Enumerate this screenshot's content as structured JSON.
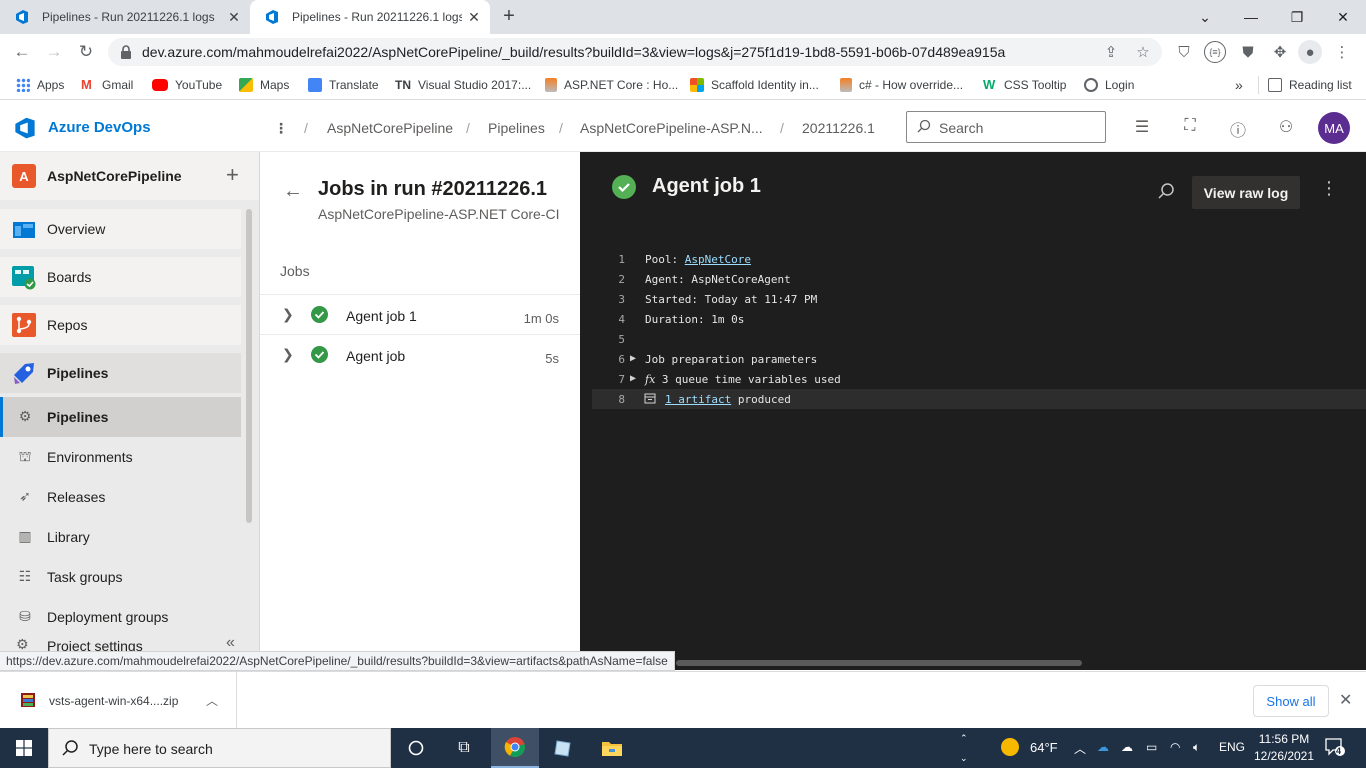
{
  "browser": {
    "tabs": [
      {
        "title": "Pipelines - Run 20211226.1 logs",
        "active": false
      },
      {
        "title": "Pipelines - Run 20211226.1 logs",
        "active": true
      }
    ],
    "url": "dev.azure.com/mahmoudelrefai2022/AspNetCorePipeline/_build/results?buildId=3&view=logs&j=275f1d19-1bd8-5591-b06b-07d489ea915a",
    "bookmarks": [
      "Apps",
      "Gmail",
      "YouTube",
      "Maps",
      "Translate",
      "Visual Studio 2017:...",
      "ASP.NET Core : Ho...",
      "Scaffold Identity in...",
      "c# - How override...",
      "CSS Tooltip",
      "Login"
    ],
    "bookmark_tn_prefix": "TN",
    "reading_list": "Reading list",
    "status_url": "https://dev.azure.com/mahmoudelrefai2022/AspNetCorePipeline/_build/results?buildId=3&view=artifacts&pathAsName=false",
    "overflow": "»"
  },
  "header": {
    "product": "Azure DevOps",
    "breadcrumbs": [
      "AspNetCorePipeline",
      "Pipelines",
      "AspNetCorePipeline-ASP.N...",
      "20211226.1"
    ],
    "search_placeholder": "Search",
    "avatar_initials": "MA"
  },
  "sidebar": {
    "project_initial": "A",
    "project_name": "AspNetCorePipeline",
    "items": [
      {
        "label": "Overview"
      },
      {
        "label": "Boards"
      },
      {
        "label": "Repos"
      },
      {
        "label": "Pipelines"
      }
    ],
    "sub_items": [
      {
        "label": "Pipelines"
      },
      {
        "label": "Environments"
      },
      {
        "label": "Releases"
      },
      {
        "label": "Library"
      },
      {
        "label": "Task groups"
      },
      {
        "label": "Deployment groups"
      }
    ],
    "project_settings": "Project settings"
  },
  "jobs": {
    "title": "Jobs in run #20211226.1",
    "subtitle": "AspNetCorePipeline-ASP.NET Core-CI",
    "section_label": "Jobs",
    "list": [
      {
        "name": "Agent job 1",
        "duration": "1m 0s",
        "status": "succeeded"
      },
      {
        "name": "Agent job",
        "duration": "5s",
        "status": "succeeded"
      }
    ]
  },
  "log": {
    "title": "Agent job 1",
    "view_raw_label": "View raw log",
    "lines": [
      {
        "n": "1",
        "prefix": "Pool: ",
        "link": "AspNetCore",
        "suffix": ""
      },
      {
        "n": "2",
        "text": "Agent: AspNetCoreAgent"
      },
      {
        "n": "3",
        "text": "Started: Today at 11:47 PM"
      },
      {
        "n": "4",
        "text": "Duration: 1m 0s"
      },
      {
        "n": "5",
        "text": ""
      },
      {
        "n": "6",
        "text": "Job preparation parameters"
      },
      {
        "n": "7",
        "fx": "fx",
        "text": "3 queue time variables used"
      },
      {
        "n": "8",
        "link": "1 artifact",
        "suffix": " produced"
      }
    ]
  },
  "downloads": {
    "file": "vsts-agent-win-x64....zip",
    "show_all": "Show all"
  },
  "taskbar": {
    "search_placeholder": "Type here to search",
    "temperature": "64°F",
    "language": "ENG",
    "time": "11:56 PM",
    "date": "12/26/2021",
    "notifications": "4"
  },
  "colors": {
    "ado_blue": "#0078d4",
    "success_green": "#339947",
    "log_bg": "#1e1e1e",
    "avatar": "#5c2d91"
  }
}
